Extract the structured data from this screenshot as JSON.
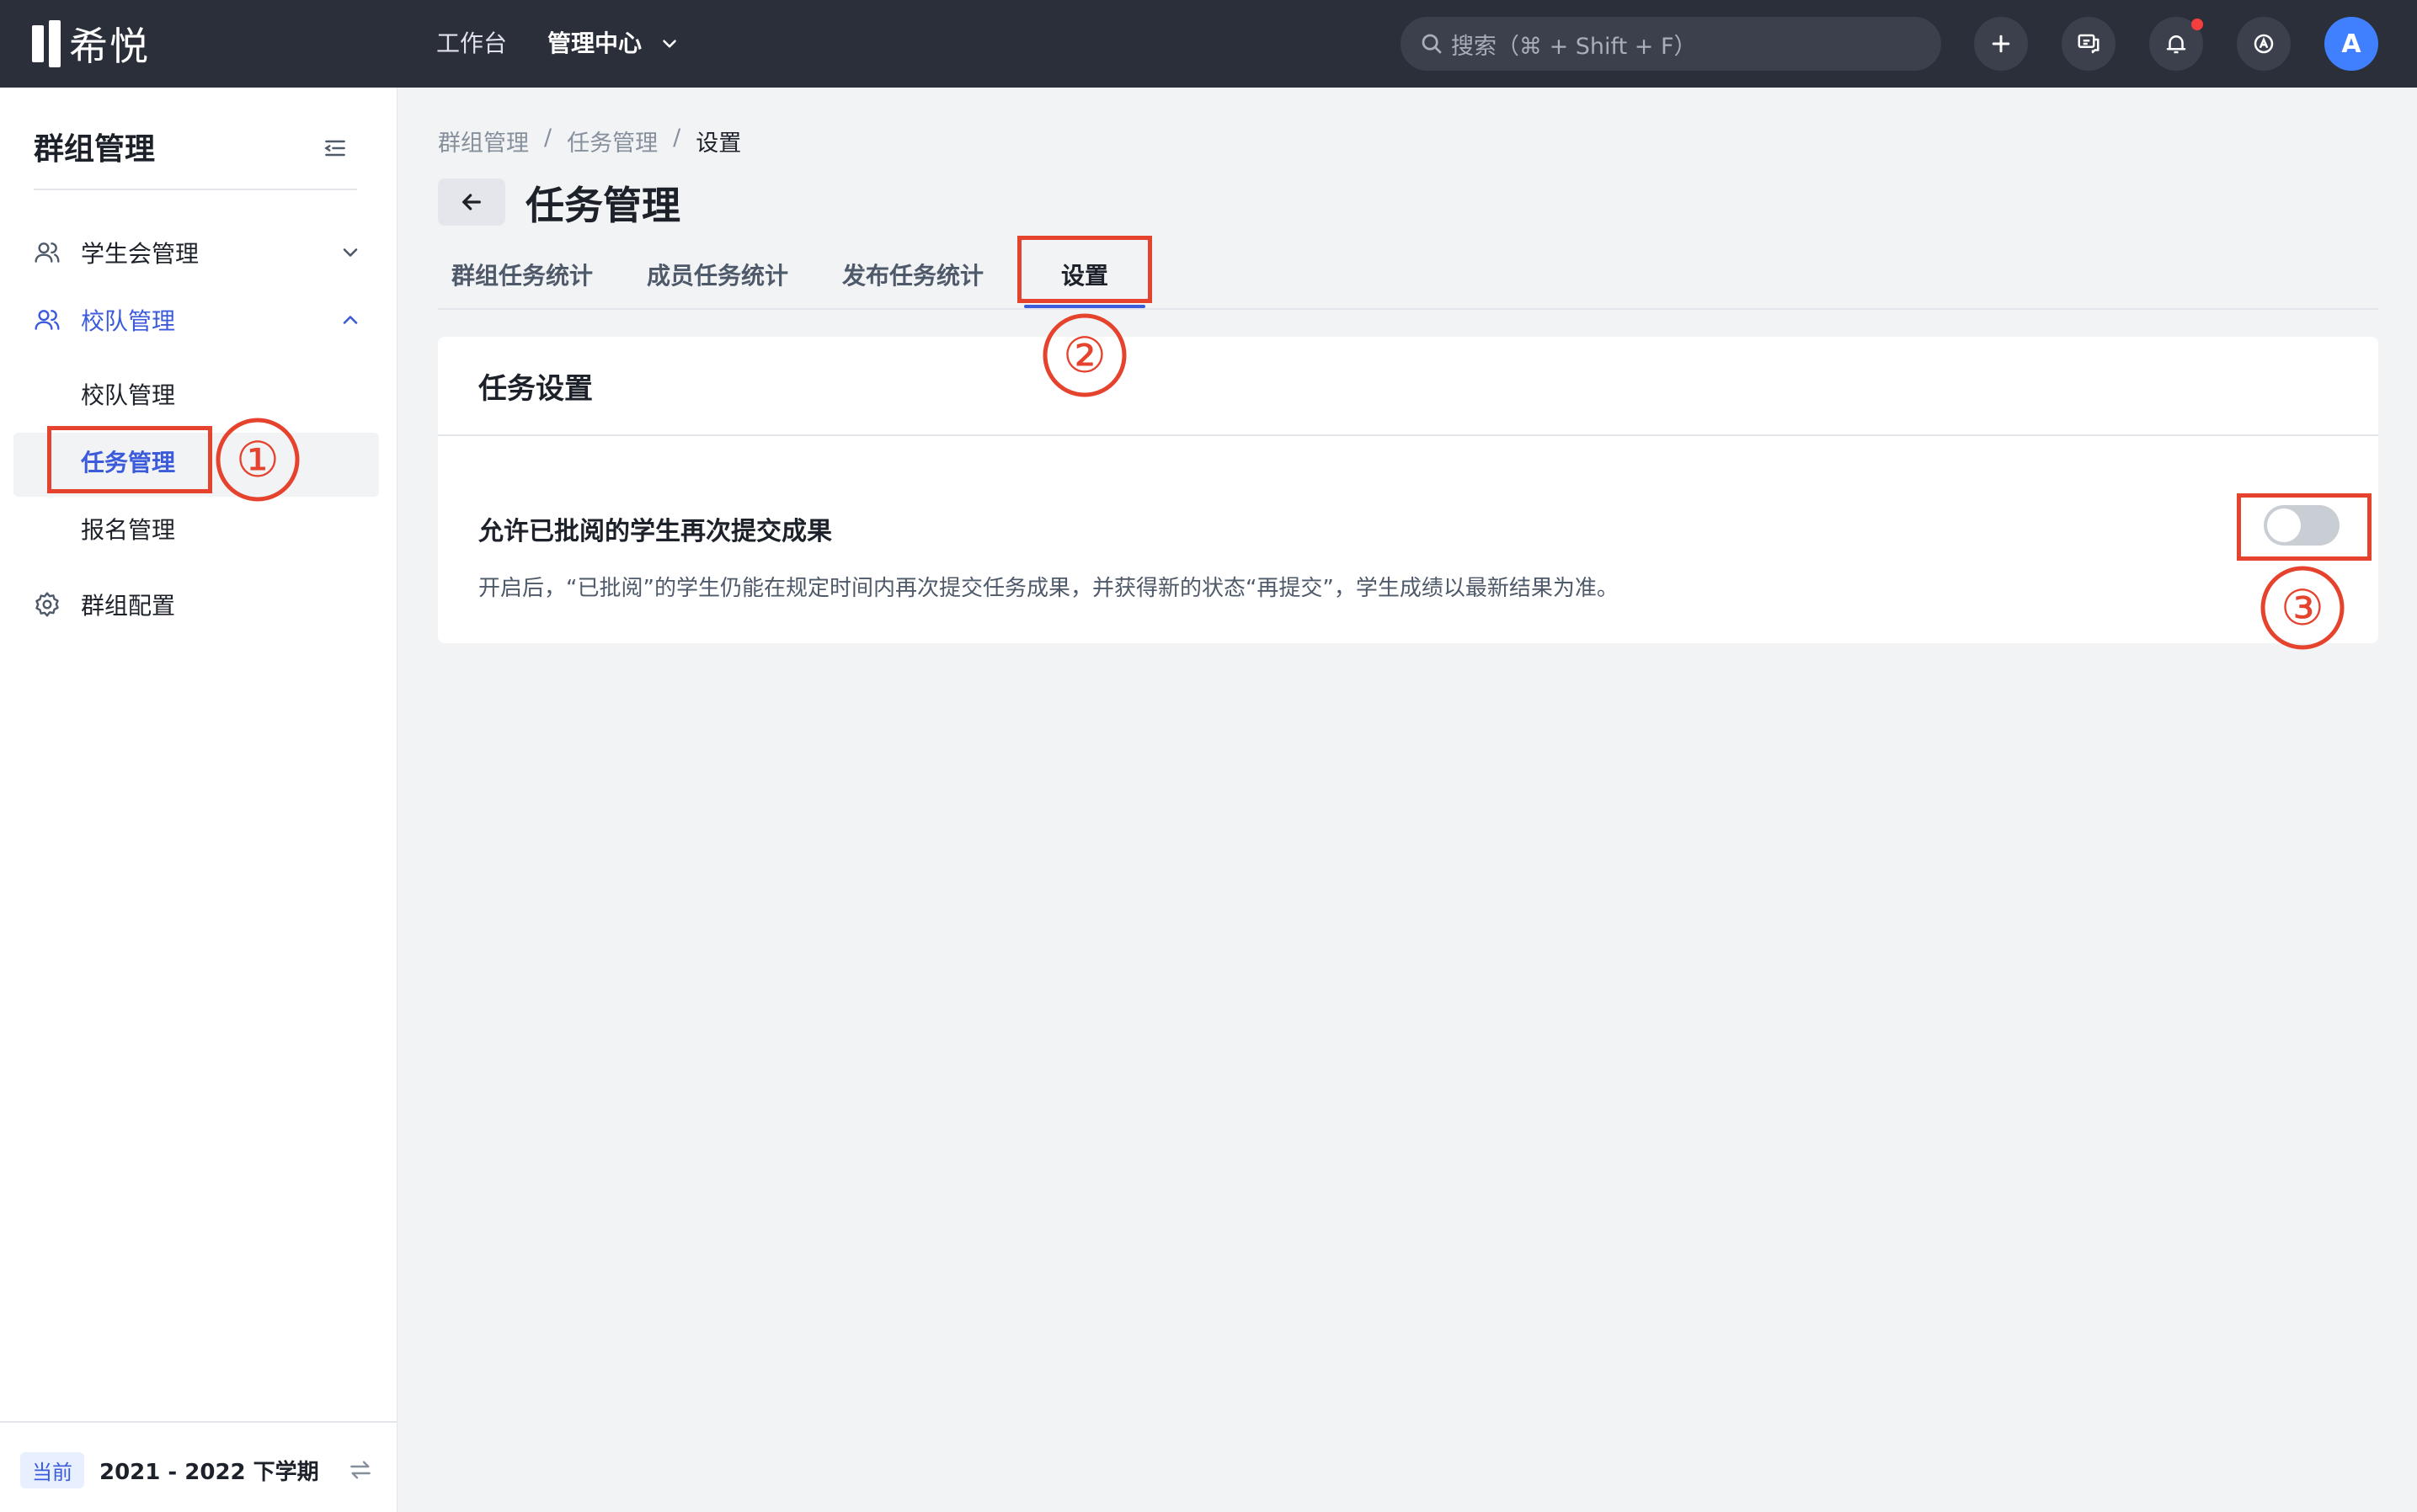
{
  "topbar": {
    "logo_text": "希悦",
    "nav_workbench": "工作台",
    "nav_admin": "管理中心",
    "search_placeholder": "搜索（⌘ + Shift + F）",
    "avatar_letter": "A"
  },
  "sidebar": {
    "title": "群组管理",
    "items": [
      {
        "label": "学生会管理"
      },
      {
        "label": "校队管理"
      },
      {
        "label": "群组配置"
      }
    ],
    "subitems": [
      {
        "label": "校队管理"
      },
      {
        "label": "任务管理"
      },
      {
        "label": "报名管理"
      }
    ],
    "footer": {
      "badge": "当前",
      "term": "2021 - 2022 下学期"
    }
  },
  "breadcrumb": [
    "群组管理",
    "任务管理",
    "设置"
  ],
  "page_title": "任务管理",
  "tabs": [
    {
      "label": "群组任务统计"
    },
    {
      "label": "成员任务统计"
    },
    {
      "label": "发布任务统计"
    },
    {
      "label": "设置"
    }
  ],
  "card": {
    "title": "任务设置",
    "setting_label": "允许已批阅的学生再次提交成果",
    "setting_desc": "开启后，“已批阅”的学生仍能在规定时间内再次提交任务成果，并获得新的状态“再提交”，学生成绩以最新结果为准。",
    "toggle_on": false
  },
  "annotations": [
    "①",
    "②",
    "③"
  ],
  "colors": {
    "topbar_bg": "#2b2f3a",
    "accent": "#3b5bdb",
    "annotation_red": "#e5432e",
    "notification_dot": "#f53f3f"
  }
}
